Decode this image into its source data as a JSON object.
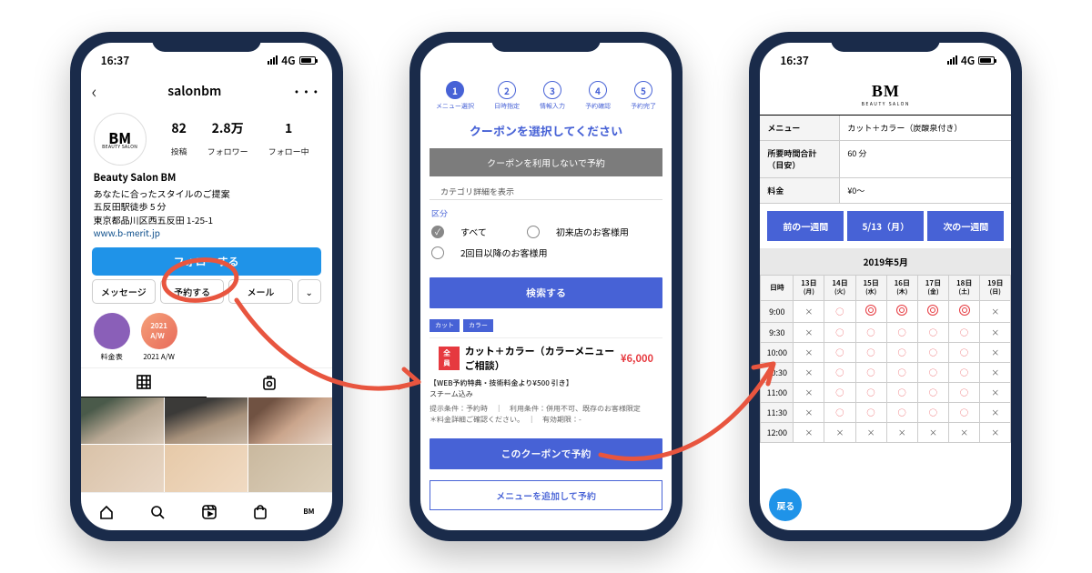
{
  "status": {
    "time": "16:37",
    "net": "4G"
  },
  "p1": {
    "username": "salonbm",
    "logo": "BM",
    "logo_sub": "BEAUTY SALON",
    "posts_n": "82",
    "posts_l": "投稿",
    "fol_n": "2.8万",
    "fol_l": "フォロワー",
    "flw_n": "1",
    "flw_l": "フォロー中",
    "name": "Beauty Salon BM",
    "bio1": "あなたに合ったスタイルのご提案",
    "bio2": "五反田駅徒歩 5 分",
    "bio3": "東京都品川区西五反田 1-25-1",
    "url": "www.b-merit.jp",
    "follow": "フォローする",
    "msg": "メッセージ",
    "book": "予約する",
    "mail": "メール",
    "hl1": "料金表",
    "hl2": "2021 A/W",
    "hl2_badge": "2021\nA/W"
  },
  "p2": {
    "steps": [
      "メニュー選択",
      "日時指定",
      "情報入力",
      "予約確認",
      "予約完了"
    ],
    "title": "クーポンを選択してください",
    "skip": "クーポンを利用しないで予約",
    "cat": "カテゴリ詳細を表示",
    "ku": "区分",
    "r_all": "すべて",
    "r_first": "初来店のお客様用",
    "r_repeat": "2回目以降のお客様用",
    "search": "検索する",
    "tag1": "カット",
    "tag2": "カラー",
    "badge": "全員",
    "ctitle": "カット＋カラー（カラーメニューご相談）",
    "price": "¥6,000",
    "note1": "【WEB予約特典・技術料金より¥500 引き】",
    "note2": "スチーム込み",
    "note3": "提示条件：予約時　｜　利用条件：併用不可、既存のお客様限定",
    "note4": "＊料金詳細ご確認ください。　｜　有効期限：-",
    "use": "このクーポンで予約",
    "add": "メニューを追加して予約"
  },
  "p3": {
    "logo": "BM",
    "logo_sub": "BEAUTY SALON",
    "k1": "メニュー",
    "v1": "カット＋カラー（炭酸泉付き）",
    "k2": "所要時間合計（目安）",
    "v2": "60 分",
    "k3": "料金",
    "v3": "¥0～",
    "prev": "前の一週間",
    "cur": "5/13（月）",
    "next": "次の一週間",
    "month": "2019年5月",
    "th0": "日時",
    "days": [
      [
        "13日",
        "(月)"
      ],
      [
        "14日",
        "(火)"
      ],
      [
        "15日",
        "(水)"
      ],
      [
        "16日",
        "(木)"
      ],
      [
        "17日",
        "(金)"
      ],
      [
        "18日",
        "(土)"
      ],
      [
        "19日",
        "(日)"
      ]
    ],
    "times": [
      "9:00",
      "9:30",
      "10:00",
      "10:30",
      "11:00",
      "11:30",
      "12:00"
    ],
    "grid": [
      [
        "x",
        "o",
        "d",
        "d",
        "d",
        "d",
        "x"
      ],
      [
        "x",
        "o",
        "o",
        "o",
        "o",
        "o",
        "x"
      ],
      [
        "x",
        "o",
        "o",
        "o",
        "o",
        "o",
        "x"
      ],
      [
        "x",
        "o",
        "o",
        "o",
        "o",
        "o",
        "x"
      ],
      [
        "x",
        "o",
        "o",
        "o",
        "o",
        "o",
        "x"
      ],
      [
        "x",
        "o",
        "o",
        "o",
        "o",
        "o",
        "x"
      ],
      [
        "x",
        "x",
        "x",
        "x",
        "x",
        "x",
        "x"
      ]
    ],
    "back": "戻る"
  }
}
